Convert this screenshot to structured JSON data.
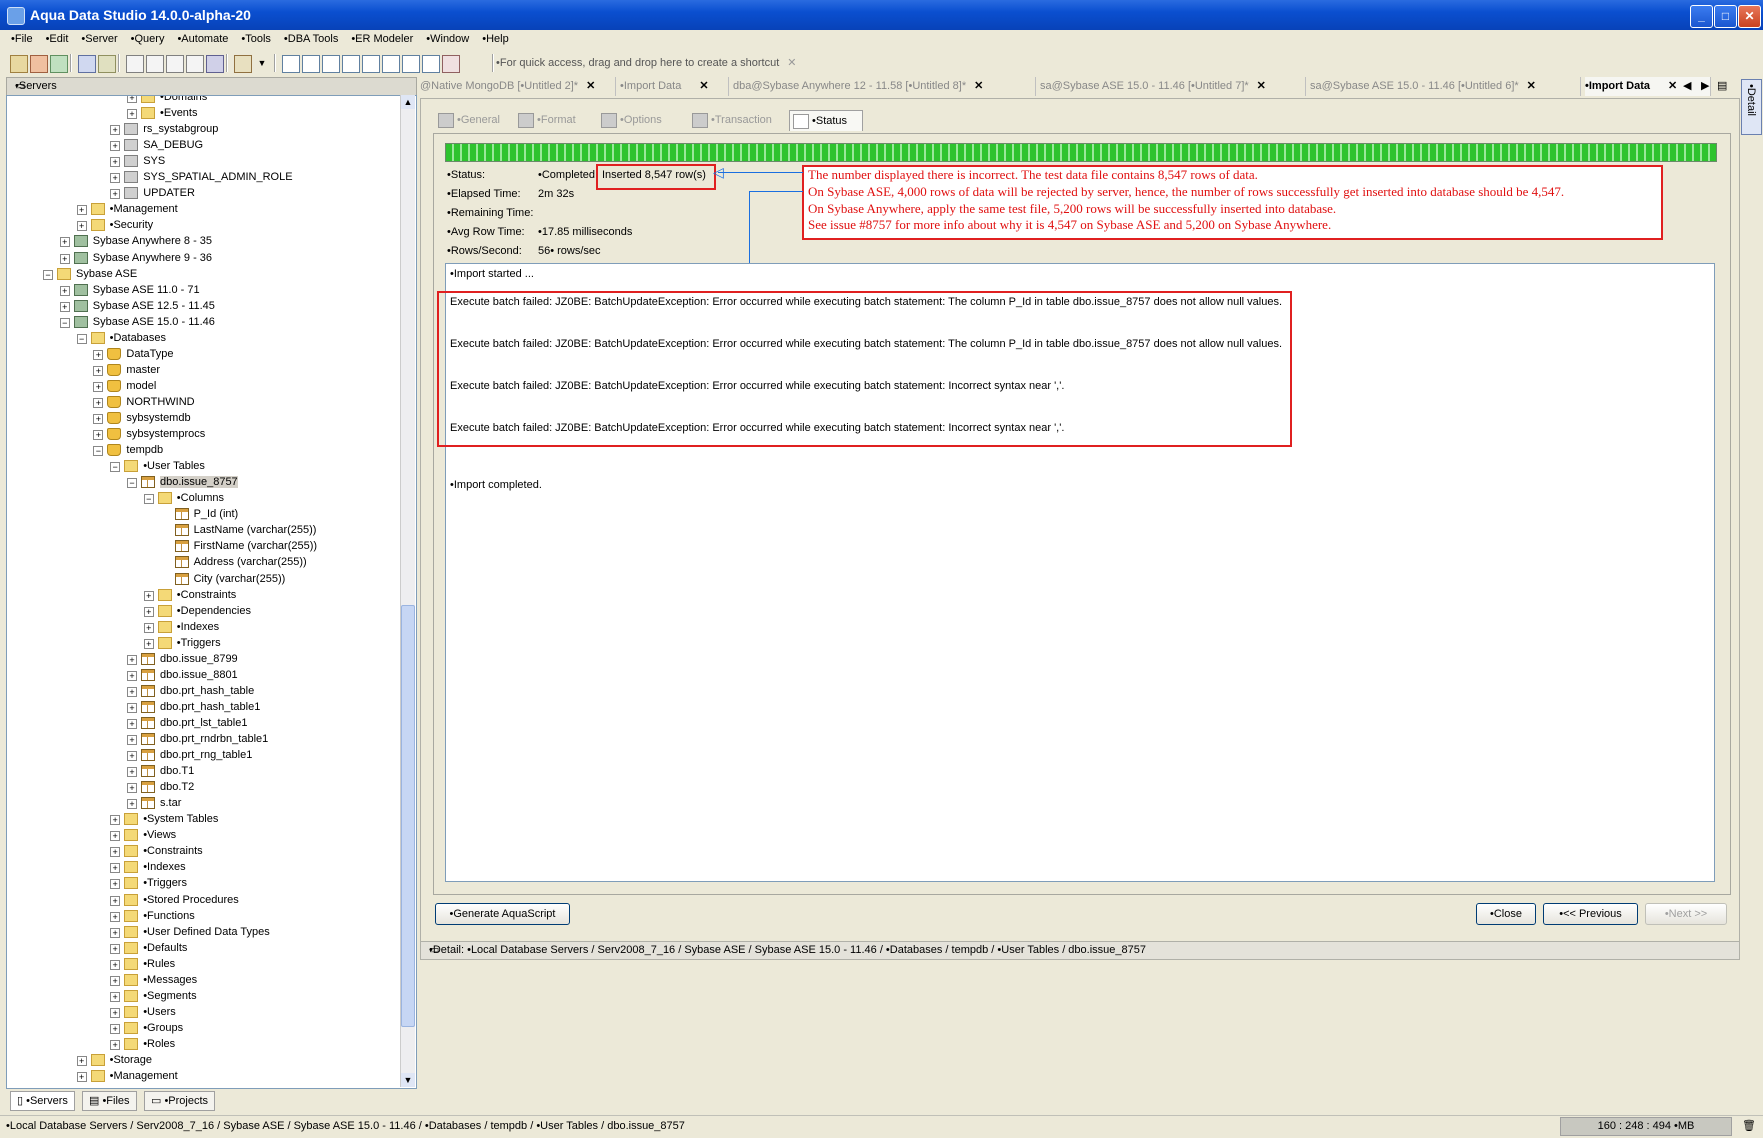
{
  "app": {
    "title": "Aqua Data Studio 14.0.0-alpha-20"
  },
  "menu": [
    "•File",
    "•Edit",
    "•Server",
    "•Query",
    "•Automate",
    "•Tools",
    "•DBA Tools",
    "•ER Modeler",
    "•Window",
    "•Help"
  ],
  "toolbar": {
    "shortcut_hint": "•For quick access, drag and drop here to create a shortcut"
  },
  "left_panel": {
    "header": "•Servers",
    "tree": [
      {
        "label": "•Domains",
        "level": 7,
        "icon": "folder"
      },
      {
        "label": "•Events",
        "level": 7,
        "icon": "folder"
      },
      {
        "label": "rs_systabgroup",
        "level": 6,
        "icon": "user"
      },
      {
        "label": "SA_DEBUG",
        "level": 6,
        "icon": "user"
      },
      {
        "label": "SYS",
        "level": 6,
        "icon": "user"
      },
      {
        "label": "SYS_SPATIAL_ADMIN_ROLE",
        "level": 6,
        "icon": "user"
      },
      {
        "label": "UPDATER",
        "level": 6,
        "icon": "user"
      },
      {
        "label": "•Management",
        "level": 4,
        "icon": "folder"
      },
      {
        "label": "•Security",
        "level": 4,
        "icon": "folder"
      },
      {
        "label": "Sybase Anywhere 8 - 35",
        "level": 3,
        "icon": "server"
      },
      {
        "label": "Sybase Anywhere 9 - 36",
        "level": 3,
        "icon": "server"
      },
      {
        "label": "Sybase ASE",
        "level": 2,
        "icon": "folder"
      },
      {
        "label": "Sybase ASE 11.0 - 71",
        "level": 3,
        "icon": "server"
      },
      {
        "label": "Sybase ASE 12.5 - 11.45",
        "level": 3,
        "icon": "server"
      },
      {
        "label": "Sybase ASE 15.0 - 11.46",
        "level": 3,
        "icon": "server"
      },
      {
        "label": "•Databases",
        "level": 4,
        "icon": "folder"
      },
      {
        "label": "DataType",
        "level": 5,
        "icon": "db"
      },
      {
        "label": "master",
        "level": 5,
        "icon": "db"
      },
      {
        "label": "model",
        "level": 5,
        "icon": "db"
      },
      {
        "label": "NORTHWIND",
        "level": 5,
        "icon": "db"
      },
      {
        "label": "sybsystemdb",
        "level": 5,
        "icon": "db"
      },
      {
        "label": "sybsystemprocs",
        "level": 5,
        "icon": "db"
      },
      {
        "label": "tempdb",
        "level": 5,
        "icon": "db"
      },
      {
        "label": "•User Tables",
        "level": 6,
        "icon": "folder"
      },
      {
        "label": "dbo.issue_8757",
        "level": 7,
        "icon": "table"
      },
      {
        "label": "•Columns",
        "level": 8,
        "icon": "folder"
      },
      {
        "label": "P_Id (int)",
        "level": 9,
        "icon": "table"
      },
      {
        "label": "LastName (varchar(255))",
        "level": 9,
        "icon": "table"
      },
      {
        "label": "FirstName (varchar(255))",
        "level": 9,
        "icon": "table"
      },
      {
        "label": "Address (varchar(255))",
        "level": 9,
        "icon": "table"
      },
      {
        "label": "City (varchar(255))",
        "level": 9,
        "icon": "table"
      },
      {
        "label": "•Constraints",
        "level": 8,
        "icon": "folder"
      },
      {
        "label": "•Dependencies",
        "level": 8,
        "icon": "folder"
      },
      {
        "label": "•Indexes",
        "level": 8,
        "icon": "folder"
      },
      {
        "label": "•Triggers",
        "level": 8,
        "icon": "folder"
      },
      {
        "label": "dbo.issue_8799",
        "level": 7,
        "icon": "table"
      },
      {
        "label": "dbo.issue_8801",
        "level": 7,
        "icon": "table"
      },
      {
        "label": "dbo.prt_hash_table",
        "level": 7,
        "icon": "table"
      },
      {
        "label": "dbo.prt_hash_table1",
        "level": 7,
        "icon": "table"
      },
      {
        "label": "dbo.prt_lst_table1",
        "level": 7,
        "icon": "table"
      },
      {
        "label": "dbo.prt_rndrbn_table1",
        "level": 7,
        "icon": "table"
      },
      {
        "label": "dbo.prt_rng_table1",
        "level": 7,
        "icon": "table"
      },
      {
        "label": "dbo.T1",
        "level": 7,
        "icon": "table"
      },
      {
        "label": "dbo.T2",
        "level": 7,
        "icon": "table"
      },
      {
        "label": "s.tar",
        "level": 7,
        "icon": "table"
      },
      {
        "label": "•System Tables",
        "level": 6,
        "icon": "folder"
      },
      {
        "label": "•Views",
        "level": 6,
        "icon": "folder"
      },
      {
        "label": "•Constraints",
        "level": 6,
        "icon": "folder"
      },
      {
        "label": "•Indexes",
        "level": 6,
        "icon": "folder"
      },
      {
        "label": "•Triggers",
        "level": 6,
        "icon": "folder"
      },
      {
        "label": "•Stored Procedures",
        "level": 6,
        "icon": "folder"
      },
      {
        "label": "•Functions",
        "level": 6,
        "icon": "folder"
      },
      {
        "label": "•User Defined Data Types",
        "level": 6,
        "icon": "folder"
      },
      {
        "label": "•Defaults",
        "level": 6,
        "icon": "folder"
      },
      {
        "label": "•Rules",
        "level": 6,
        "icon": "folder"
      },
      {
        "label": "•Messages",
        "level": 6,
        "icon": "folder"
      },
      {
        "label": "•Segments",
        "level": 6,
        "icon": "folder"
      },
      {
        "label": "•Users",
        "level": 6,
        "icon": "folder"
      },
      {
        "label": "•Groups",
        "level": 6,
        "icon": "folder"
      },
      {
        "label": "•Roles",
        "level": 6,
        "icon": "folder"
      },
      {
        "label": "•Storage",
        "level": 4,
        "icon": "folder"
      },
      {
        "label": "•Management",
        "level": 4,
        "icon": "folder"
      }
    ],
    "selected": "dbo.issue_8757",
    "bottom_tabs": [
      "•Servers",
      "•Files",
      "•Projects"
    ]
  },
  "doc_tabs": [
    {
      "label": "@Native MongoDB [•Untitled 2]*",
      "active": false
    },
    {
      "label": "•Import Data",
      "active": false
    },
    {
      "label": "dba@Sybase Anywhere 12 - 11.58 [•Untitled 8]*",
      "active": false
    },
    {
      "label": "sa@Sybase ASE 15.0 - 11.46 [•Untitled 7]*",
      "active": false
    },
    {
      "label": "sa@Sybase ASE 15.0 - 11.46 [•Untitled 6]*",
      "active": false
    },
    {
      "label": "•Import Data",
      "active": true
    }
  ],
  "wizard_tabs": [
    "•General",
    "•Format",
    "•Options",
    "•Transaction",
    "•Status"
  ],
  "status": {
    "status_label": "•Status:",
    "status_value": "•Completed:",
    "inserted": "Inserted 8,547 row(s)",
    "elapsed_label": "•Elapsed Time:",
    "elapsed_value": "2m 32s",
    "remaining_label": "•Remaining Time:",
    "remaining_value": "",
    "avg_label": "•Avg Row Time:",
    "avg_value": "•17.85 milliseconds",
    "rps_label": "•Rows/Second:",
    "rps_value": "56• rows/sec",
    "progress": 1.0
  },
  "annotation": [
    "The number displayed there is incorrect. The test data file contains 8,547 rows of data.",
    "On Sybase ASE, 4,000 rows of data will be rejected by server, hence, the number of rows successfully get inserted into database should be 4,547.",
    "On Sybase Anywhere, apply the same test file, 5,200 rows will be successfully inserted into database.",
    "See issue #8757 for more info about why it is 4,547 on Sybase ASE and 5,200 on Sybase Anywhere."
  ],
  "log": {
    "started": "•Import started ...",
    "errors": [
      "Execute batch failed: JZ0BE: BatchUpdateException: Error occurred while executing batch statement: The column P_Id in table dbo.issue_8757 does not allow null values.",
      "Execute batch failed: JZ0BE: BatchUpdateException: Error occurred while executing batch statement: The column P_Id in table dbo.issue_8757 does not allow null values.",
      "Execute batch failed: JZ0BE: BatchUpdateException: Error occurred while executing batch statement: Incorrect syntax near ','.",
      "Execute batch failed: JZ0BE: BatchUpdateException: Error occurred while executing batch statement: Incorrect syntax near ','."
    ],
    "completed": "•Import completed."
  },
  "buttons": {
    "generate": "•Generate AquaScript",
    "close": "•Close",
    "previous": "•<< Previous",
    "next": "•Next >>"
  },
  "detail_bar": "•Detail: •Local Database Servers / Serv2008_7_16 / Sybase ASE / Sybase ASE 15.0 - 11.46 / •Databases / tempdb / •User Tables / dbo.issue_8757",
  "right_strip": "•Detail",
  "statusbar": {
    "path": "•Local Database Servers / Serv2008_7_16 / Sybase ASE / Sybase ASE 15.0 - 11.46 / •Databases / tempdb / •User Tables / dbo.issue_8757",
    "memory": "160 : 248 : 494 •MB"
  }
}
